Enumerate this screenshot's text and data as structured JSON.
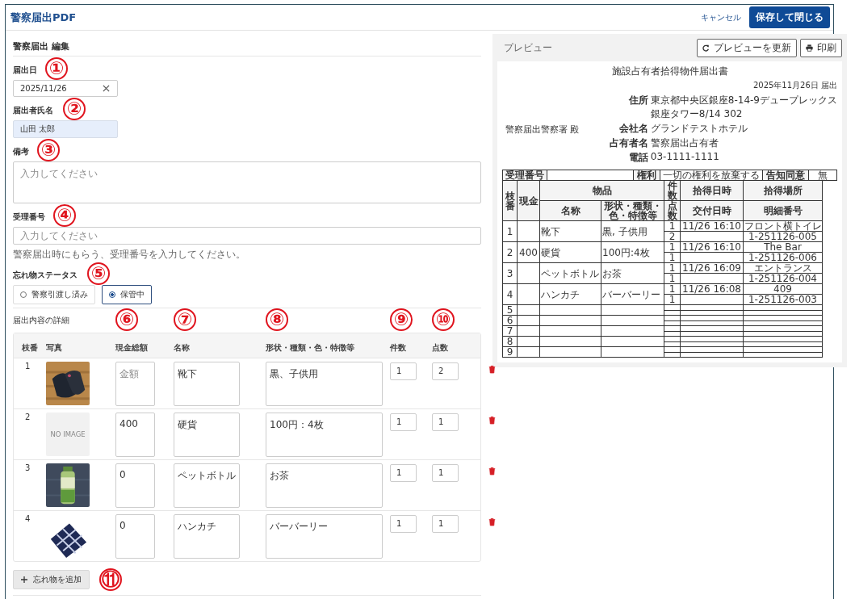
{
  "app": {
    "title": "警察届出PDF",
    "cancel": "キャンセル",
    "save": "保存して閉じる"
  },
  "form": {
    "heading": "警察届出 編集",
    "date": {
      "label": "届出日",
      "value": "2025/11/26",
      "marker": "①"
    },
    "reporter": {
      "label": "届出者氏名",
      "value": "山田 太郎",
      "marker": "②"
    },
    "remarks": {
      "label": "備考",
      "placeholder": "入力してください",
      "marker": "③"
    },
    "receipt": {
      "label": "受理番号",
      "placeholder": "入力してください",
      "help": "警察届出時にもらう、受理番号を入力してください。",
      "marker": "④"
    },
    "status": {
      "label": "忘れ物ステータス",
      "marker": "⑤",
      "options": [
        {
          "label": "警察引渡し済み",
          "selected": false
        },
        {
          "label": "保管中",
          "selected": true
        }
      ]
    }
  },
  "details": {
    "heading": "届出内容の詳細",
    "columns": [
      {
        "label": "枝番"
      },
      {
        "label": "写真"
      },
      {
        "label": "現金総額",
        "marker": "⑥"
      },
      {
        "label": "名称",
        "marker": "⑦"
      },
      {
        "label": "形状・種類・色・特徴等",
        "marker": "⑧"
      },
      {
        "label": "件数",
        "marker": "⑨"
      },
      {
        "label": "点数",
        "marker": "⑩"
      }
    ],
    "rows": [
      {
        "no": "1",
        "cash": {
          "placeholder": "金額"
        },
        "name": "靴下",
        "description": "黒、子供用",
        "count": "1",
        "points": "2"
      },
      {
        "no": "2",
        "photo": {
          "kind": "empty",
          "text": "NO IMAGE"
        },
        "cash": {
          "value": "400"
        },
        "name": "硬貨",
        "description": "100円：4枚",
        "count": "1",
        "points": "1"
      },
      {
        "no": "3",
        "cash": {
          "value": "0"
        },
        "name": "ペットボトル",
        "description": "お茶",
        "count": "1",
        "points": "1"
      },
      {
        "no": "4",
        "cash": {
          "value": "0"
        },
        "name": "ハンカチ",
        "description": "バーバーリー",
        "count": "1",
        "points": "1"
      }
    ],
    "add_button": {
      "label": "忘れ物を追加",
      "marker": "⑪"
    }
  },
  "preview": {
    "label": "プレビュー",
    "refresh": "プレビューを更新",
    "print": "印刷",
    "document": {
      "title": "施設占有者拾得物件届出書",
      "date": "2025年11月26日 届出",
      "addressee": "警察届出警察署 殿",
      "info": [
        {
          "label": "住所",
          "lines": [
            "東京都中央区銀座8-14-9デュープレックス",
            "銀座タワー8/14 302"
          ]
        },
        {
          "label": "会社名",
          "lines": [
            "グランドテストホテル"
          ]
        },
        {
          "label": "占有者名",
          "lines": [
            "警察届出占有者"
          ]
        },
        {
          "label": "電話",
          "lines": [
            "03-1111-1111"
          ]
        }
      ],
      "top_row": {
        "receipt_label": "受理番号",
        "rights_label": "権利",
        "rights_value": "一切の権利を放棄する",
        "consent_label": "告知同意",
        "consent_value": "無"
      },
      "header_1": [
        "枝番",
        "現金",
        "物品",
        "件数",
        "拾得日時",
        "拾得場所"
      ],
      "header_2": [
        "名称",
        "形状・種類・色・特徴等",
        "点数",
        "交付日時",
        "明細番号"
      ],
      "rows": [
        {
          "no": "1",
          "name": "靴下",
          "description": "黒, 子供用",
          "count": "1",
          "found_at": "11/26 16:10",
          "place": "フロント横トイレ",
          "points": "2",
          "detail_no": "1-251126-005"
        },
        {
          "no": "2",
          "cash": "400",
          "name": "硬貨",
          "description": "100円:4枚",
          "count": "1",
          "found_at": "11/26 16:10",
          "place": "The Bar",
          "points": "1",
          "detail_no": "1-251126-006"
        },
        {
          "no": "3",
          "name": "ペットボトル",
          "description": "お茶",
          "count": "1",
          "found_at": "11/26 16:09",
          "place": "エントランス",
          "points": "1",
          "detail_no": "1-251126-004"
        },
        {
          "no": "4",
          "name": "ハンカチ",
          "description": "バーバーリー",
          "count": "1",
          "found_at": "11/26 16:08",
          "place": "409",
          "points": "1",
          "detail_no": "1-251126-003"
        },
        {
          "no": "5"
        },
        {
          "no": "6"
        },
        {
          "no": "7"
        },
        {
          "no": "8"
        },
        {
          "no": "9"
        }
      ]
    }
  }
}
